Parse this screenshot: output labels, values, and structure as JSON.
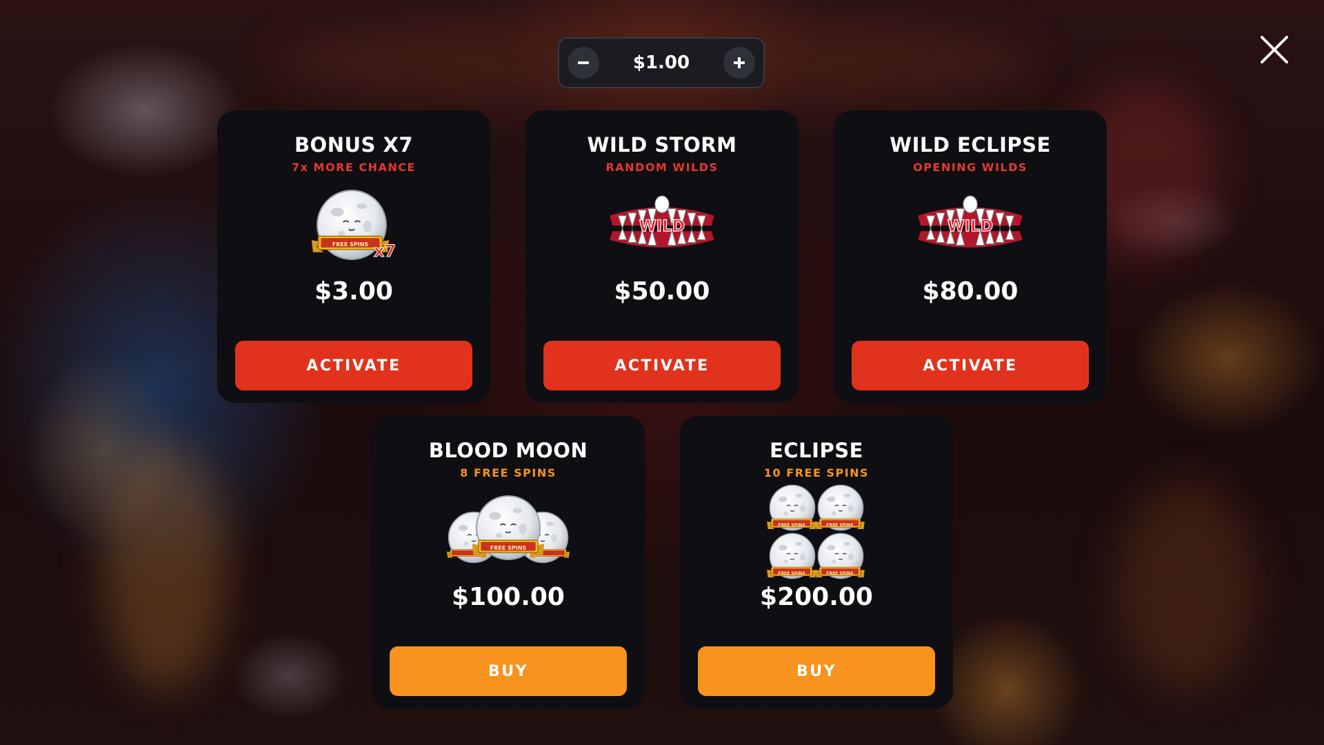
{
  "bet": {
    "value": "$1.00",
    "minus_label": "−",
    "plus_label": "+"
  },
  "close_icon": "close-icon",
  "colors": {
    "panel": "#0f0e12",
    "activate_button": "#e0321c",
    "buy_button": "#f7931e",
    "subtitle_red": "#e5392c",
    "subtitle_orange": "#f7941d"
  },
  "features": [
    {
      "title": "BONUS X7",
      "subtitle": "7x MORE CHANCE",
      "price": "$3.00",
      "button": "ACTIVATE",
      "icon": "moon-free-spins-x7-icon",
      "moon_badge": "FREE SPINS",
      "multiplier": "x7"
    },
    {
      "title": "WILD STORM",
      "subtitle": "RANDOM WILDS",
      "price": "$50.00",
      "button": "ACTIVATE",
      "icon": "wild-fangs-icon",
      "badge": "WILD"
    },
    {
      "title": "WILD ECLIPSE",
      "subtitle": "OPENING WILDS",
      "price": "$80.00",
      "button": "ACTIVATE",
      "icon": "wild-fangs-icon",
      "badge": "WILD"
    },
    {
      "title": "BLOOD MOON",
      "subtitle": "8 FREE SPINS",
      "price": "$100.00",
      "button": "BUY",
      "icon": "three-moons-free-spins-icon",
      "moon_badge": "FREE SPINS"
    },
    {
      "title": "ECLIPSE",
      "subtitle": "10 FREE SPINS",
      "price": "$200.00",
      "button": "BUY",
      "icon": "four-moons-free-spins-icon",
      "moon_badge": "FREE SPINS"
    }
  ]
}
